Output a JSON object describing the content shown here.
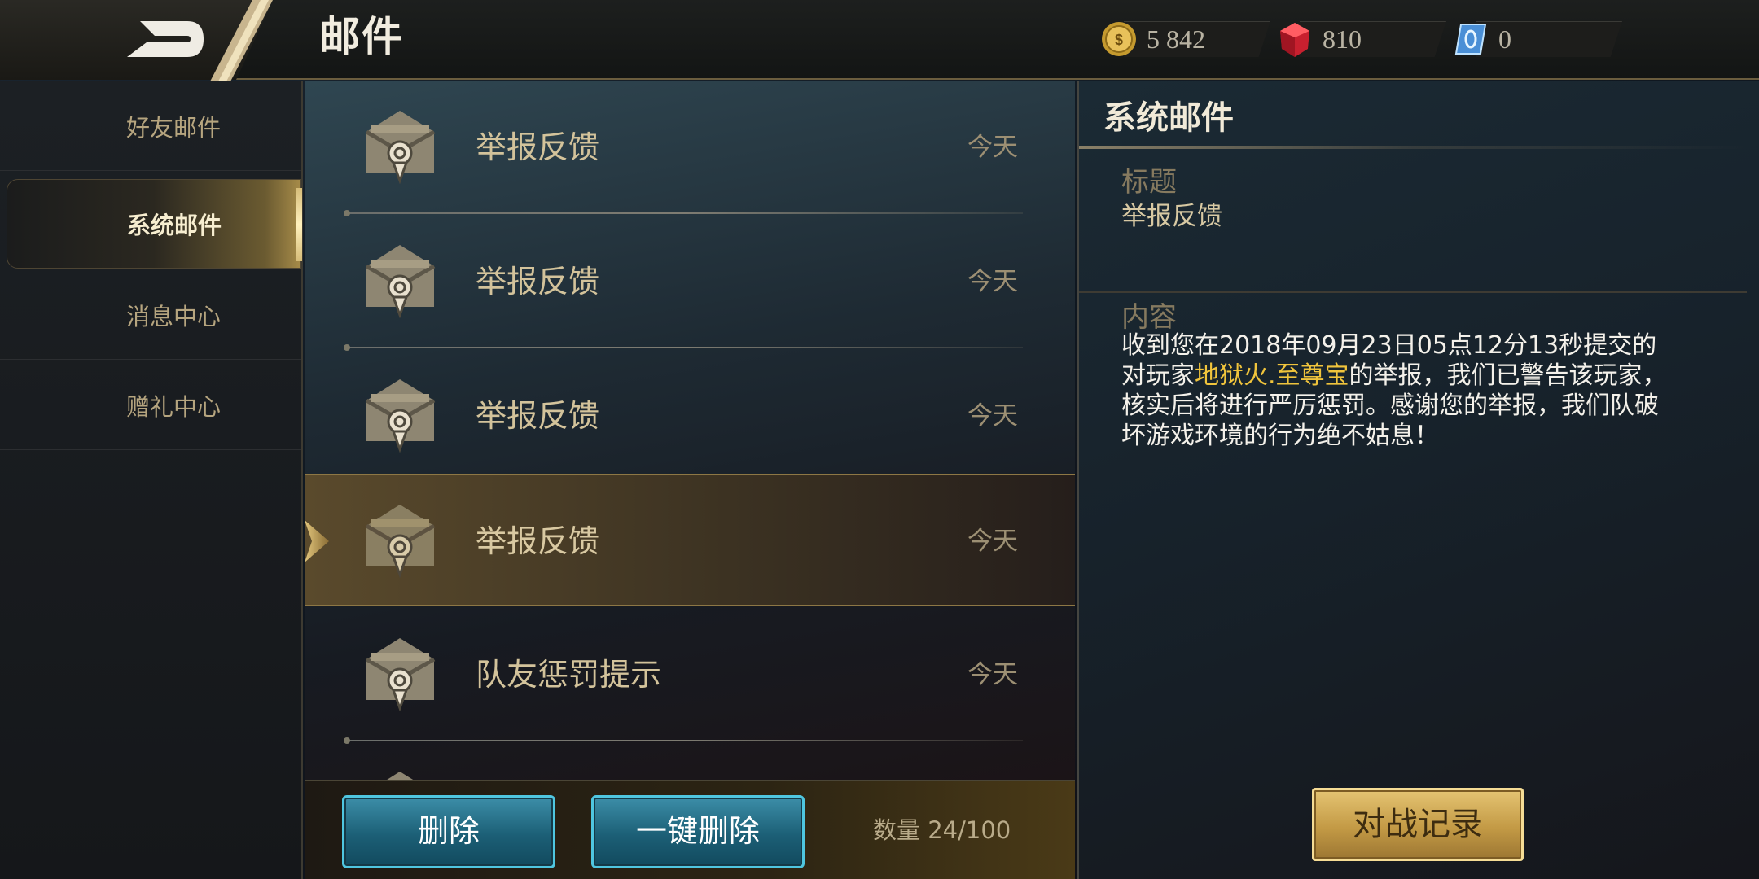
{
  "header": {
    "title": "邮件",
    "currencies": [
      {
        "icon": "gold-coin-icon",
        "value": "5 842"
      },
      {
        "icon": "ruby-gem-icon",
        "value": "810"
      },
      {
        "icon": "blue-voucher-icon",
        "value": "0"
      }
    ]
  },
  "sidebar": {
    "items": [
      {
        "label": "好友邮件"
      },
      {
        "label": "系统邮件"
      },
      {
        "label": "消息中心"
      },
      {
        "label": "赠礼中心"
      }
    ],
    "active_index": 1
  },
  "mail_list": {
    "items": [
      {
        "subject": "举报反馈",
        "date": "今天",
        "icon": "envelope-seal-icon"
      },
      {
        "subject": "举报反馈",
        "date": "今天",
        "icon": "envelope-seal-icon"
      },
      {
        "subject": "举报反馈",
        "date": "今天",
        "icon": "envelope-seal-icon"
      },
      {
        "subject": "举报反馈",
        "date": "今天",
        "icon": "envelope-seal-icon"
      },
      {
        "subject": "队友惩罚提示",
        "date": "今天",
        "icon": "envelope-seal-icon"
      }
    ],
    "selected_index": 3
  },
  "actions": {
    "delete_label": "删除",
    "delete_all_label": "一键删除",
    "count_label": "数量 24/100"
  },
  "detail": {
    "section_title": "系统邮件",
    "subject_label": "标题",
    "subject_value": "举报反馈",
    "content_label": "内容",
    "content_before": "收到您在2018年09月23日05点12分13秒提交的对玩家",
    "content_highlight": "地狱火.至尊宝",
    "content_after": "的举报，我们已警告该玩家，核实后将进行严厉惩罚。感谢您的举报，我们队破坏游戏环境的行为绝不姑息！",
    "battle_record_label": "对战记录"
  },
  "colors": {
    "accent_gold": "#d6bc78",
    "highlight_yellow": "#f0c43c",
    "button_blue": "#1c5f76",
    "button_blue_border": "#4fc6e0"
  }
}
